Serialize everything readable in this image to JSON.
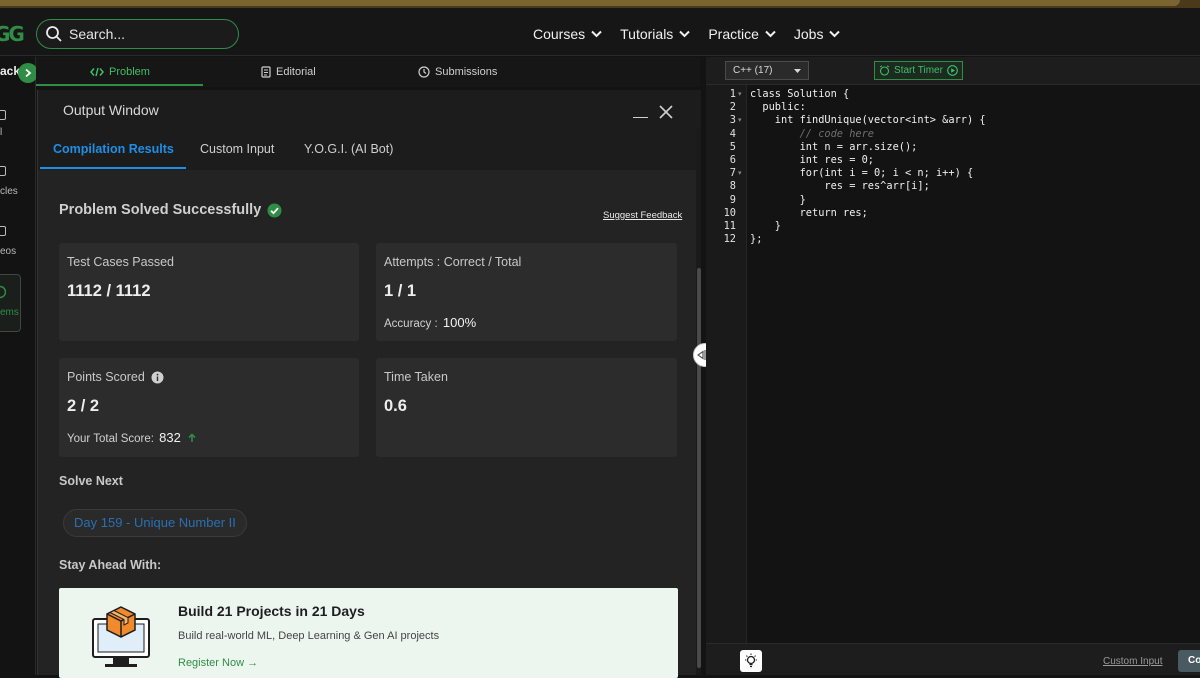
{
  "colors": {
    "brand": "#2f8d46",
    "tab_active": "#1f8fe6",
    "link_blue": "#2a6fb0"
  },
  "header": {
    "logo_text": "GG",
    "search_placeholder": "Search...",
    "nav": [
      {
        "label": "Courses"
      },
      {
        "label": "Tutorials"
      },
      {
        "label": "Practice"
      },
      {
        "label": "Jobs"
      }
    ]
  },
  "sidebar": {
    "back_label": "ack",
    "items": [
      {
        "label": "l"
      },
      {
        "label": "cles"
      },
      {
        "label": "eos"
      },
      {
        "label": "ems"
      }
    ]
  },
  "problem_tabs": [
    {
      "label": "Problem",
      "icon": "code-icon"
    },
    {
      "label": "Editorial",
      "icon": "document-icon"
    },
    {
      "label": "Submissions",
      "icon": "clock-icon"
    }
  ],
  "output_window": {
    "title": "Output Window",
    "tabs": [
      {
        "label": "Compilation Results"
      },
      {
        "label": "Custom Input"
      },
      {
        "label": "Y.O.G.I. (AI Bot)"
      }
    ],
    "status": "Problem Solved Successfully",
    "suggest_feedback": "Suggest Feedback",
    "cards": {
      "test_cases": {
        "label": "Test Cases Passed",
        "value": "1112 / 1112"
      },
      "attempts": {
        "label": "Attempts : Correct / Total",
        "value": "1 / 1",
        "sub_label": "Accuracy :",
        "sub_value": "100%"
      },
      "points": {
        "label": "Points Scored",
        "value": "2 / 2",
        "sub_label": "Your Total Score:",
        "sub_value": "832"
      },
      "time": {
        "label": "Time Taken",
        "value": "0.6"
      }
    },
    "solve_next_heading": "Solve Next",
    "solve_next_item": "Day 159 - Unique Number II",
    "stay_ahead_heading": "Stay Ahead With:",
    "promo": {
      "title": "Build 21 Projects in 21 Days",
      "description": "Build real-world ML, Deep Learning & Gen AI projects",
      "link": "Register Now →"
    }
  },
  "editor": {
    "language": "C++ (17)",
    "timer_label": "Start Timer",
    "code_lines": [
      "class Solution {",
      "  public:",
      "    int findUnique(vector<int> &arr) {",
      "        // code here",
      "        int n = arr.size();",
      "        int res = 0;",
      "        for(int i = 0; i < n; i++) {",
      "            res = res^arr[i];",
      "        }",
      "        return res;",
      "    }",
      "};"
    ],
    "line_numbers": [
      "1",
      "2",
      "3",
      "4",
      "5",
      "6",
      "7",
      "8",
      "9",
      "10",
      "11",
      "12"
    ],
    "custom_input_link": "Custom Input",
    "compile_label": "Co"
  }
}
